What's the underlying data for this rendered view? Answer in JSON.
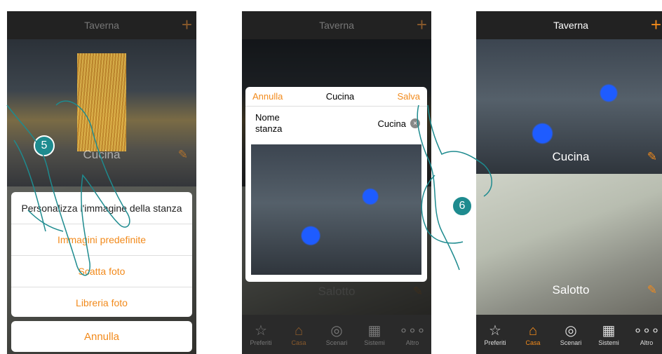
{
  "panel1": {
    "title": "Taverna",
    "plus": "+",
    "room_label": "Cucina",
    "pencil": "✎",
    "sheet": {
      "heading": "Personalizza l'immagine della stanza",
      "options": [
        "Immagini predefinite",
        "Scatta foto",
        "Libreria foto"
      ]
    },
    "cancel": "Annulla",
    "step": "5"
  },
  "panel2": {
    "title": "Taverna",
    "plus": "+",
    "dialog": {
      "cancel": "Annulla",
      "title": "Cucina",
      "save": "Salva",
      "field_label": "Nome stanza",
      "field_value": "Cucina",
      "clear": "×"
    },
    "room_label": "Salotto",
    "pencil": "✎",
    "tabs": [
      {
        "label": "Preferiti",
        "icon": "star-icon",
        "glyph": "☆"
      },
      {
        "label": "Casa",
        "icon": "home-icon",
        "glyph": "⌂"
      },
      {
        "label": "Scenari",
        "icon": "scenes-icon",
        "glyph": "◎"
      },
      {
        "label": "Sistemi",
        "icon": "grid-icon",
        "glyph": "▦"
      },
      {
        "label": "Altro",
        "icon": "more-icon",
        "glyph": "∘∘∘"
      }
    ]
  },
  "panel3": {
    "title": "Taverna",
    "plus": "+",
    "rooms": [
      "Cucina",
      "Salotto"
    ],
    "pencil": "✎",
    "tabs": [
      {
        "label": "Preferiti",
        "icon": "star-icon",
        "glyph": "☆"
      },
      {
        "label": "Casa",
        "icon": "home-icon",
        "glyph": "⌂"
      },
      {
        "label": "Scenari",
        "icon": "scenes-icon",
        "glyph": "◎"
      },
      {
        "label": "Sistemi",
        "icon": "grid-icon",
        "glyph": "▦"
      },
      {
        "label": "Altro",
        "icon": "more-icon",
        "glyph": "∘∘∘"
      }
    ],
    "step": "6"
  },
  "colors": {
    "accent": "#f28a1b",
    "step_badge": "#1e8b8f",
    "hand_outline": "#1e8b8f"
  }
}
